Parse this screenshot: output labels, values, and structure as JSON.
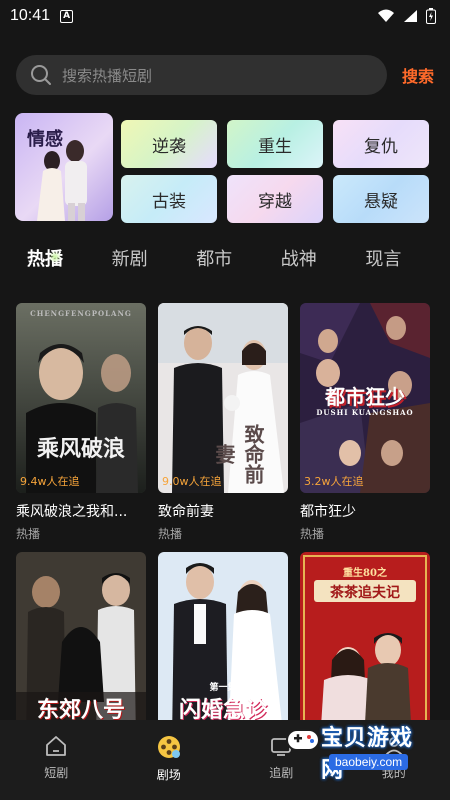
{
  "status_bar": {
    "time": "10:41",
    "notification_letter": "A"
  },
  "search": {
    "placeholder": "搜索热播短剧",
    "button_label": "搜索"
  },
  "categories": {
    "featured_label": "情感",
    "buttons": [
      "逆袭",
      "重生",
      "复仇",
      "古装",
      "穿越",
      "悬疑"
    ]
  },
  "tabs": [
    "热播",
    "新剧",
    "都市",
    "战神",
    "现言"
  ],
  "dramas": [
    {
      "title": "乘风破浪之我和...",
      "tag": "热播",
      "views": "9.4w人在追",
      "poster_text": "乘风破浪",
      "poster_sub": "CHENGFENGPOLANG"
    },
    {
      "title": "致命前妻",
      "tag": "热播",
      "views": "9.0w人在追",
      "poster_text": "致命前妻",
      "poster_sub": ""
    },
    {
      "title": "都市狂少",
      "tag": "热播",
      "views": "3.2w人在追",
      "poster_text": "都市狂少",
      "poster_sub": "DUSHI KUANGSHAO"
    },
    {
      "title": "",
      "tag": "",
      "views": "",
      "poster_text": "东郊八号",
      "poster_sub": ""
    },
    {
      "title": "",
      "tag": "",
      "views": "",
      "poster_text": "闪婚急诊",
      "poster_sub": "第一集"
    },
    {
      "title": "",
      "tag": "",
      "views": "",
      "poster_text": "茶茶追夫记",
      "poster_sub": "重生80之"
    }
  ],
  "bottom_nav": [
    {
      "label": "短剧",
      "icon": "home-icon"
    },
    {
      "label": "剧场",
      "icon": "theater-icon"
    },
    {
      "label": "追剧",
      "icon": "tv-icon"
    },
    {
      "label": "我的",
      "icon": "user-icon"
    }
  ],
  "watermark": {
    "title": "宝贝游戏网",
    "url": "baobeiy.com"
  },
  "colors": {
    "accent": "#ff6a2a",
    "views": "#f6a43a",
    "background": "#161616"
  }
}
